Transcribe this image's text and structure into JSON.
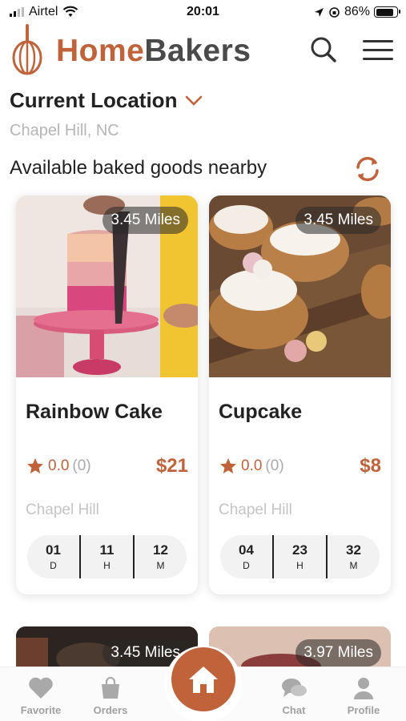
{
  "status_bar": {
    "carrier": "Airtel",
    "time": "20:01",
    "battery": "86%"
  },
  "header": {
    "logo_part1": "Home",
    "logo_part2": "Bakers",
    "icons": [
      "whisk-icon",
      "search-icon",
      "menu-icon"
    ]
  },
  "location": {
    "title": "Current Location",
    "city": "Chapel Hill, NC"
  },
  "section_title": "Available baked goods nearby",
  "products": [
    {
      "name": "Rainbow Cake",
      "distance": "3.45 Miles",
      "rating": "0.0",
      "rating_count": "(0)",
      "price": "$21",
      "city": "Chapel Hill",
      "timer": [
        {
          "value": "01",
          "unit": "D"
        },
        {
          "value": "11",
          "unit": "H"
        },
        {
          "value": "12",
          "unit": "M"
        }
      ]
    },
    {
      "name": "Cupcake",
      "distance": "3.45 Miles",
      "rating": "0.0",
      "rating_count": "(0)",
      "price": "$8",
      "city": "Chapel Hill",
      "timer": [
        {
          "value": "04",
          "unit": "D"
        },
        {
          "value": "23",
          "unit": "H"
        },
        {
          "value": "32",
          "unit": "M"
        }
      ]
    }
  ],
  "more_products": [
    {
      "distance": "3.45 Miles"
    },
    {
      "distance": "3.97 Miles"
    }
  ],
  "bottom_nav": {
    "favorite": "Favorite",
    "orders": "Orders",
    "chat": "Chat",
    "profile": "Profile"
  },
  "colors": {
    "accent": "#c0623a",
    "text_dark": "#222222",
    "text_muted": "#b5b5b5"
  }
}
